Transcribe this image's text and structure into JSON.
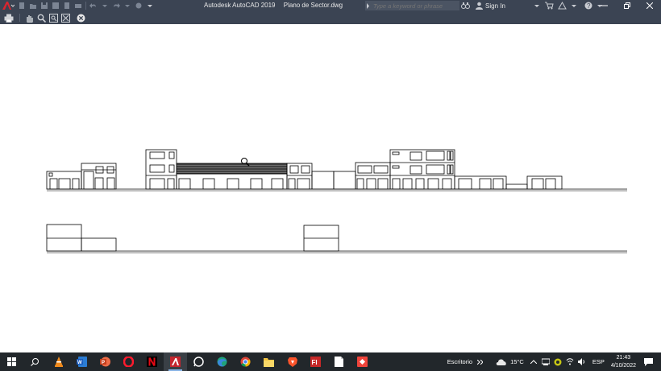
{
  "app": {
    "title": "Autodesk AutoCAD 2019",
    "document": "Plano de Sector.dwg",
    "brand_color": "#c4262e"
  },
  "search": {
    "placeholder": "Type a keyword or phrase"
  },
  "account": {
    "signin_label": "Sign In"
  },
  "quick_access_icons": [
    "new-icon",
    "open-icon",
    "save-icon",
    "save-as-icon",
    "plot-icon",
    "undo-icon",
    "redo-icon",
    "workspace-icon",
    "dropdown-icon"
  ],
  "window_controls": [
    "minimize-icon",
    "restore-icon",
    "close-icon"
  ],
  "navbar_icons": [
    "print-icon",
    "pan-icon",
    "zoom-icon",
    "zoom-window-icon",
    "zoom-extents-icon",
    "close-circle-icon"
  ],
  "taskbar": {
    "apps": [
      "start-icon",
      "search-icon",
      "vlc-icon",
      "word-icon",
      "powerpoint-icon",
      "opera-icon",
      "netflix-icon",
      "autocad-icon",
      "whatsapp-icon",
      "edge-icon",
      "chrome-icon",
      "file-explorer-icon",
      "brave-icon",
      "flash-icon",
      "notepad-icon",
      "anydesk-icon"
    ],
    "desktop_label": "Escritorio",
    "temperature": "15°C",
    "language": "ESP",
    "time": "21:43",
    "date": "4/10/2022"
  }
}
